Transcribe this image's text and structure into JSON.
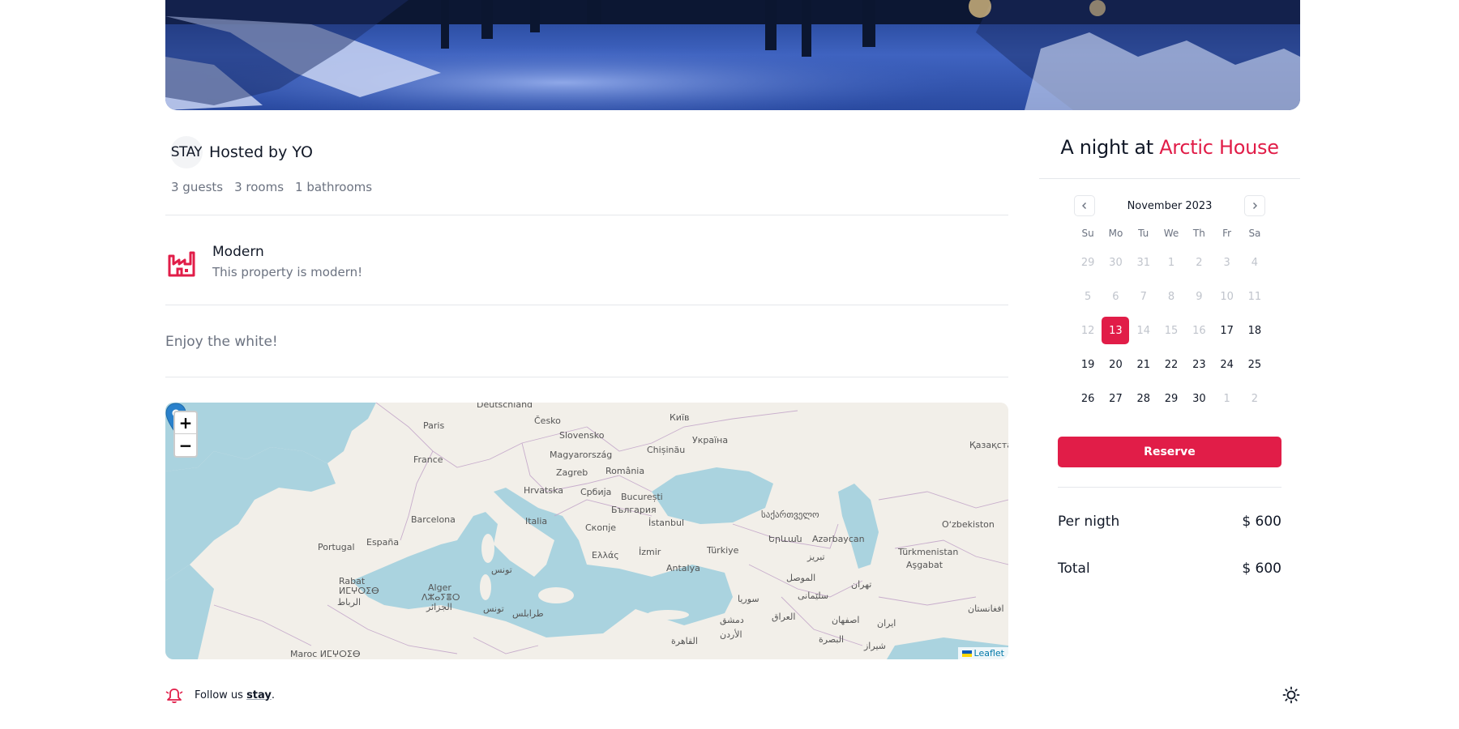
{
  "host": {
    "avatar_text": "STAY",
    "title": "Hosted by YO",
    "stats": [
      "3 guests",
      "3 rooms",
      "1 bathrooms"
    ]
  },
  "feature": {
    "icon": "factory-icon",
    "title": "Modern",
    "description": "This property is modern!"
  },
  "description": "Enjoy the white!",
  "map": {
    "zoom_in": "+",
    "zoom_out": "−",
    "attribution": "Leaflet",
    "labels": {
      "deutschland": "Deutschland",
      "cesko": "Česko",
      "kyiv": "Київ",
      "paris": "Paris",
      "slovensko": "Slovensko",
      "ukraine": "Україна",
      "france": "France",
      "magyarorszag": "Magyarország",
      "chisinau": "Chișinău",
      "kazakhstan": "Қазақстан",
      "zagreb": "Zagreb",
      "romania": "România",
      "hrvatska": "Hrvatska",
      "srbija": "Србија",
      "bucuresti": "București",
      "barcelona": "Barcelona",
      "balgariya": "България",
      "italia": "Italia",
      "skopje": "Скопје",
      "istanbul": "İstanbul",
      "sakartvelo": "საქართველო",
      "azarbaycan": "Azərbaycan",
      "ozbekiston": "Oʻzbekiston",
      "espana": "España",
      "portugal": "Portugal",
      "ellas": "Ελλάς",
      "izmir": "İzmir",
      "turkiye": "Türkiye",
      "yerevan": "Երևան",
      "turkmenistan": "Türkmenistan",
      "tabriz": "تبریز",
      "ashgabat": "Aşgabat",
      "antalya": "Antalya",
      "tunis": "تونس",
      "rabat": "Rabat",
      "maroc_tifinagh": "ⵍⵎⵖⵔⵉⴱ",
      "rabat_ar": "الرباط",
      "alger": "Alger",
      "alger_tifinagh": "ⴷⵣⴰⵢⴻⵔ",
      "aljazair": "الجزائر",
      "tunisia_ar": "تونس",
      "tarabulus": "طرابلس",
      "souriya": "سوريا",
      "iraq": "العراق",
      "mosul": "الموصل",
      "sulaymaniyah": "سلێمانی",
      "tehran": "تهران",
      "afghanistan": "افغانستان",
      "dimashq": "دمشق",
      "iran": "ایران",
      "isfahan": "اصفهان",
      "al_urdun": "الأردن",
      "al_qahira": "القاهرة",
      "al_basra": "البصرة",
      "shiraz": "شیراز",
      "maroc": "Maroc ⵍⵎⵖⵔⵉⴱ"
    }
  },
  "footer": {
    "text_prefix": "Follow us ",
    "link": "stay",
    "text_suffix": "."
  },
  "booking": {
    "title_prefix": "A night at ",
    "title_accent": "Arctic House",
    "month": "November 2023",
    "weekdays": [
      "Su",
      "Mo",
      "Tu",
      "We",
      "Th",
      "Fr",
      "Sa"
    ],
    "weeks": [
      [
        {
          "d": "29",
          "m": true
        },
        {
          "d": "30",
          "m": true
        },
        {
          "d": "31",
          "m": true
        },
        {
          "d": "1",
          "m": true
        },
        {
          "d": "2",
          "m": true
        },
        {
          "d": "3",
          "m": true
        },
        {
          "d": "4",
          "m": true
        }
      ],
      [
        {
          "d": "5",
          "m": true
        },
        {
          "d": "6",
          "m": true
        },
        {
          "d": "7",
          "m": true
        },
        {
          "d": "8",
          "m": true
        },
        {
          "d": "9",
          "m": true
        },
        {
          "d": "10",
          "m": true
        },
        {
          "d": "11",
          "m": true
        }
      ],
      [
        {
          "d": "12",
          "m": true
        },
        {
          "d": "13",
          "s": true
        },
        {
          "d": "14",
          "m": true
        },
        {
          "d": "15",
          "m": true
        },
        {
          "d": "16",
          "m": true
        },
        {
          "d": "17"
        },
        {
          "d": "18"
        }
      ],
      [
        {
          "d": "19"
        },
        {
          "d": "20"
        },
        {
          "d": "21"
        },
        {
          "d": "22"
        },
        {
          "d": "23"
        },
        {
          "d": "24"
        },
        {
          "d": "25"
        }
      ],
      [
        {
          "d": "26"
        },
        {
          "d": "27"
        },
        {
          "d": "28"
        },
        {
          "d": "29"
        },
        {
          "d": "30"
        },
        {
          "d": "1",
          "m": true
        },
        {
          "d": "2",
          "m": true
        }
      ]
    ],
    "reserve_label": "Reserve",
    "per_night_label": "Per nigth",
    "per_night_value": "$ 600",
    "total_label": "Total",
    "total_value": "$ 600",
    "accent_color": "#e11d48"
  }
}
